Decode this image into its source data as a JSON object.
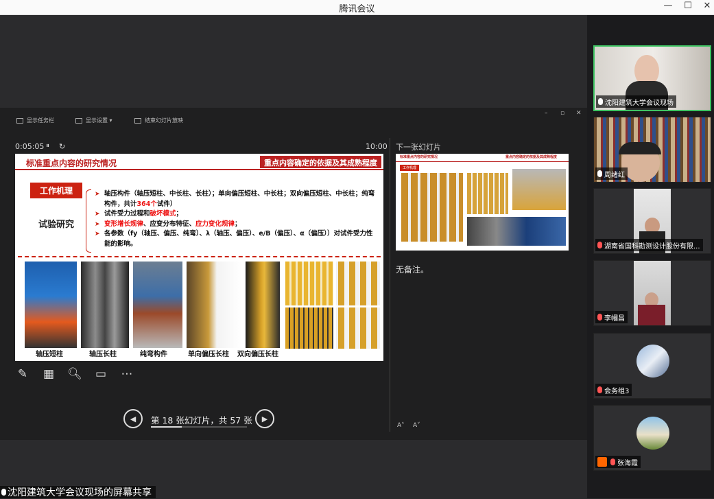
{
  "app": {
    "title": "腾讯会议"
  },
  "window_controls": {
    "minimize": "—",
    "maximize": "☐",
    "close": "✕"
  },
  "presenter_toolbar": {
    "taskbar": "显示任务栏",
    "display_settings": "显示设置 ▾",
    "end_show": "结束幻灯片放映"
  },
  "presenter_window": {
    "min": "–",
    "restore": "▫",
    "close": "✕"
  },
  "timer": {
    "elapsed": "0:05:05",
    "pause": "⏸",
    "reset": "↻",
    "clock": "10:00"
  },
  "slide": {
    "title_left": "标准重点内容的研究情况",
    "title_right": "重点内容确定的依据及其成熟程度",
    "section": "工作机理",
    "topic": "试验研究",
    "bullets": {
      "b1": "轴压构件（轴压短柱、中长柱、长柱）；单向偏压短柱、中长柱；双向偏压短柱、中长柱；纯弯构件，共计",
      "b1_red": "364个",
      "b1_end": "试件）",
      "b2": "试件受力过程和",
      "b2_red": "破坏模式",
      "b2_end": "；",
      "b3_red": "变形增长规律",
      "b3": "、应变分布特征、",
      "b3_red2": "应力变化规律",
      "b3_end": "；",
      "b4": "各参数（fy（轴压、偏压、纯弯）、λ（轴压、偏压）、e/B（偏压）、α（偏压））对试件受力性能的影响。"
    },
    "captions": [
      "轴压短柱",
      "轴压长柱",
      "纯弯构件",
      "单向偏压长柱",
      "双向偏压长柱"
    ]
  },
  "navigation": {
    "prev": "◀",
    "next": "▶",
    "label": "第 18 张幻灯片，共 57 张",
    "progress": 0.32
  },
  "next_slide": {
    "title": "下一张幻灯片",
    "t1": "标准重点内容的研究情况",
    "t2": "重点内容确定的依据及其成熟程度",
    "tag": "工作机理"
  },
  "notes": {
    "text": "无备注。"
  },
  "font_controls": {
    "increase": "A˄",
    "decrease": "A˅"
  },
  "share_banner": {
    "text": "沈阳建筑大学会议现场的屏幕共享"
  },
  "participants": [
    {
      "name": "沈阳建筑大学会议现场",
      "muted": false,
      "active": true
    },
    {
      "name": "周绪红",
      "muted": false
    },
    {
      "name": "湖南省国科勘测设计股份有限...",
      "muted": true
    },
    {
      "name": "李幗昌",
      "muted": true
    },
    {
      "name": "会务组3",
      "muted": true
    },
    {
      "name": "张海霞",
      "muted": true
    }
  ],
  "colors": {
    "accent_red": "#c21",
    "active_border": "#3fc463"
  }
}
